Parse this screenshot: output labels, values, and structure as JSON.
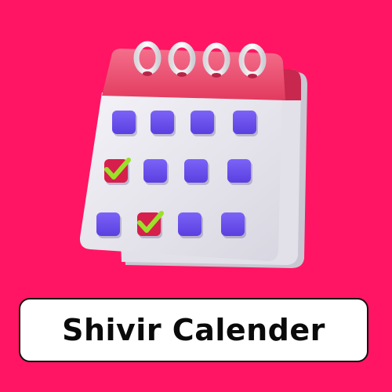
{
  "title": "Shivir Calender",
  "icon": "calendar-icon",
  "colors": {
    "background": "#ff1563",
    "calendar_header": "#ef4a6c",
    "calendar_page": "#ecebf1",
    "day_square": "#6b4ff0",
    "checked_square": "#d61f4b",
    "checkmark": "#9be02a",
    "ring": "#f4f4f6"
  },
  "calendar": {
    "rows": [
      [
        "plain",
        "plain",
        "plain",
        "plain"
      ],
      [
        "checked",
        "plain",
        "plain",
        "plain"
      ],
      [
        "plain",
        "checked",
        "plain",
        "plain"
      ]
    ]
  }
}
